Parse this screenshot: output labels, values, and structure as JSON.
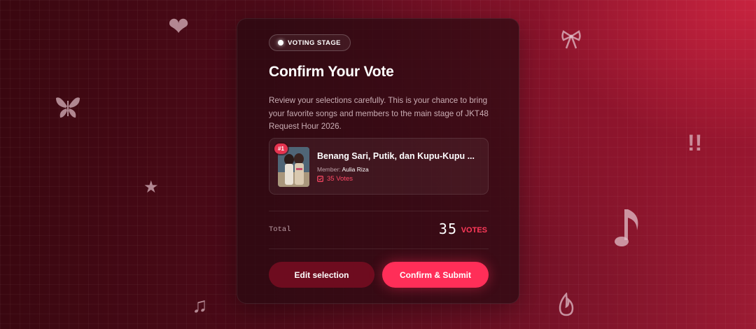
{
  "badge": {
    "label": "VOTING STAGE"
  },
  "heading": "Confirm Your Vote",
  "description": "Review your selections carefully. This is your chance to bring your favorite songs and members to the main stage of JKT48 Request Hour 2026.",
  "selection": {
    "rank": "#1",
    "song_title": "Benang Sari, Putik, dan Kupu-Kupu ...",
    "member_label": "Member:",
    "member_name": "Aulia Riza",
    "votes_text": "35 Votes"
  },
  "total": {
    "label": "Total",
    "count": "35",
    "unit": "VOTES"
  },
  "buttons": {
    "edit": "Edit selection",
    "confirm": "Confirm & Submit"
  },
  "icons": [
    "heart-icon",
    "bow-icon",
    "butterfly-icon",
    "exclamation-icon",
    "star-icon",
    "music-note-icon",
    "double-music-note-icon",
    "fire-icon",
    "ballot-icon"
  ],
  "colors": {
    "accent": "#ff2e58",
    "vote_text": "#ff4a66",
    "edit_button": "#6e0c1f"
  }
}
